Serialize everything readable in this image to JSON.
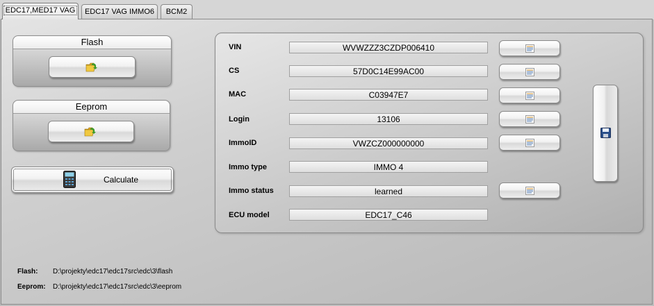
{
  "tabs": [
    {
      "label": "EDC17,MED17 VAG",
      "active": true
    },
    {
      "label": "EDC17 VAG IMMO6",
      "active": false
    },
    {
      "label": "BCM2",
      "active": false
    }
  ],
  "flash_group": {
    "title": "Flash",
    "button_icon": "folder-open-icon"
  },
  "eeprom_group": {
    "title": "Eeprom",
    "button_icon": "folder-open-icon"
  },
  "calculate": {
    "label": "Calculate",
    "icon": "calculator-icon"
  },
  "fields": [
    {
      "label": "VIN",
      "value": "WVWZZZ3CZDP006410",
      "has_button": true
    },
    {
      "label": "CS",
      "value": "57D0C14E99AC00",
      "has_button": true
    },
    {
      "label": "MAC",
      "value": "C03947E7",
      "has_button": true
    },
    {
      "label": "Login",
      "value": "13106",
      "has_button": true
    },
    {
      "label": "ImmoID",
      "value": "VWZCZ000000000",
      "has_button": true
    },
    {
      "label": "Immo type",
      "value": "IMMO 4",
      "has_button": false
    },
    {
      "label": "Immo status",
      "value": "learned",
      "has_button": true
    },
    {
      "label": "ECU model",
      "value": "EDC17_C46",
      "has_button": false
    }
  ],
  "copy_button_icon": "copy-text-icon",
  "save_button_icon": "floppy-disk-icon",
  "paths": {
    "flash_label": "Flash:",
    "flash_value": "D:\\projekty\\edc17\\edc17src\\edc\\3\\flash",
    "eeprom_label": "Eeprom:",
    "eeprom_value": "D:\\projekty\\edc17\\edc17src\\edc\\3\\eeprom"
  },
  "colors": {
    "folder": "#e8b830",
    "arrow": "#3a9a2a",
    "floppy": "#2a4f8a"
  }
}
